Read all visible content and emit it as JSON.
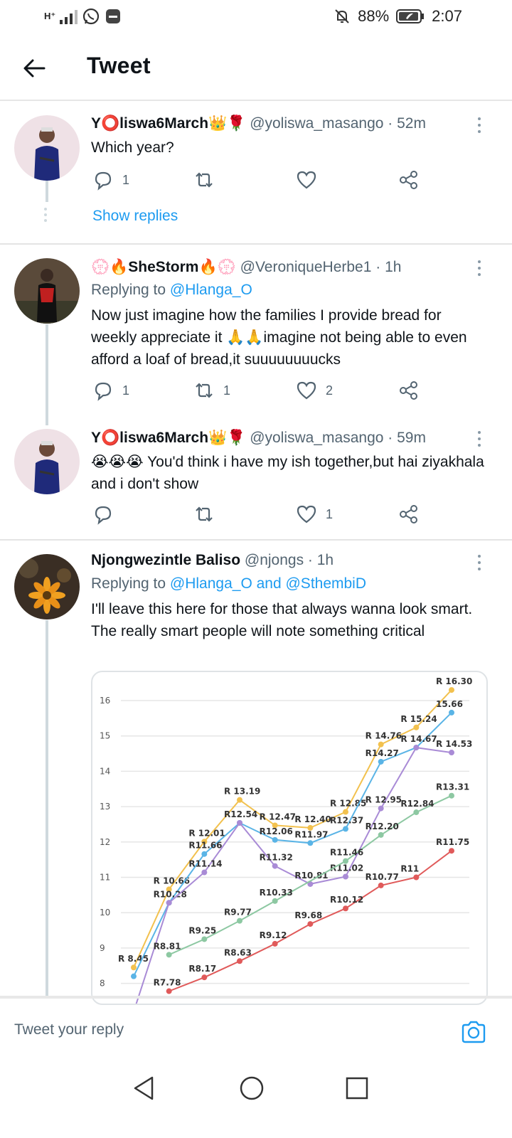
{
  "status": {
    "network": "H⁺",
    "battery": "88%",
    "time": "2:07"
  },
  "header": {
    "title": "Tweet"
  },
  "tweets": [
    {
      "name": "Y⭕liswa6March👑🌹",
      "handle": "@yoliswa_masango · 52m",
      "text": "Which year?",
      "replies": "1",
      "retweets": "",
      "likes": "",
      "show_replies": "Show replies"
    },
    {
      "name": "💮🔥SheStorm🔥💮",
      "handle": "@VeroniqueHerbe1 · 1h",
      "replying_prefix": "Replying to",
      "replying_to": "@Hlanga_O",
      "text": "Now just imagine how the families I provide bread for weekly appreciate it 🙏🙏imagine not being able to even afford a loaf of bread,it suuuuuuuucks",
      "replies": "1",
      "retweets": "1",
      "likes": "2"
    },
    {
      "name": "Y⭕liswa6March👑🌹",
      "handle": "@yoliswa_masango · 59m",
      "text": "😭😭😭 You'd think i have my ish together,but hai ziyakhala and i don't show",
      "replies": "",
      "retweets": "",
      "likes": "1"
    },
    {
      "name": "Njongwezintle Baliso",
      "handle": "@njongs · 1h",
      "replying_prefix": "Replying to",
      "replying_to": "@Hlanga_O and @SthembiD",
      "text": "I'll leave this here for those that always wanna look smart. The really smart people will note something critical"
    }
  ],
  "reply_bar": {
    "placeholder": "Tweet your reply"
  },
  "colors": {
    "accent": "#1d9bf0",
    "muted": "#536471"
  },
  "chart_data": {
    "type": "line",
    "ylim": [
      7.5,
      16.5
    ],
    "yticks": [
      8,
      9,
      10,
      11,
      12,
      13,
      14,
      15,
      16
    ],
    "x": [
      1,
      2,
      3,
      4,
      5,
      6,
      7,
      8,
      9,
      10,
      11,
      12,
      13,
      14,
      15,
      16,
      17,
      18,
      19
    ],
    "series": [
      {
        "color": "#f2c14e",
        "values": [
          8.45,
          null,
          10.66,
          null,
          12.01,
          null,
          13.19,
          null,
          12.47,
          null,
          12.4,
          null,
          12.85,
          null,
          14.76,
          null,
          15.24,
          null,
          16.3
        ],
        "labels": [
          "R 8.45",
          "",
          "R 10.66",
          "",
          "R 12.01",
          "",
          "R 13.19",
          "",
          "R 12.47",
          "",
          "R 12.40",
          "",
          "R 12.85",
          "",
          "R 14.76",
          "",
          "R 15.24",
          "",
          "R 16.30"
        ]
      },
      {
        "color": "#5ab4e6",
        "values": [
          8.2,
          null,
          10.28,
          null,
          11.66,
          null,
          12.54,
          null,
          12.06,
          null,
          11.97,
          null,
          12.37,
          null,
          14.27,
          null,
          14.67,
          null,
          15.66
        ],
        "labels": [
          "",
          "",
          "R10.28",
          "",
          "R11.66",
          "",
          "R12.54",
          "",
          "R12.06",
          "",
          "R11.97",
          "",
          "R12.37",
          "",
          "R14.27",
          "",
          "R 14.67",
          "",
          "15.66"
        ]
      },
      {
        "color": "#a98bd6",
        "values": [
          7.2,
          null,
          10.28,
          null,
          11.14,
          null,
          12.54,
          null,
          11.32,
          null,
          10.81,
          null,
          11.02,
          null,
          12.95,
          null,
          14.67,
          null,
          14.53
        ],
        "labels": [
          "",
          "",
          "",
          "",
          "R11.14",
          "",
          "",
          "",
          "R11.32",
          "",
          "R10.81",
          "",
          "R11.02",
          "",
          "R 12.95",
          "",
          "",
          "",
          "R 14.53"
        ]
      },
      {
        "color": "#8dc8a2",
        "values": [
          null,
          null,
          8.81,
          null,
          9.25,
          null,
          9.77,
          null,
          10.33,
          null,
          null,
          null,
          11.46,
          null,
          12.2,
          null,
          12.84,
          null,
          13.31
        ],
        "labels": [
          "",
          "",
          "R8.81",
          "",
          "R9.25",
          "",
          "R9.77",
          "",
          "R10.33",
          "",
          "",
          "",
          "R11.46",
          "",
          "R12.20",
          "",
          "R12.84",
          "",
          "R13.31"
        ]
      },
      {
        "color": "#e05a5a",
        "values": [
          null,
          null,
          7.78,
          null,
          8.17,
          null,
          8.63,
          null,
          9.12,
          null,
          9.68,
          null,
          10.12,
          null,
          10.77,
          null,
          11,
          null,
          11.75
        ],
        "labels": [
          "",
          "",
          "R7.78",
          "",
          "R8.17",
          "",
          "R8.63",
          "",
          "R9.12",
          "",
          "R9.68",
          "",
          "R10.12",
          "",
          "R10.77",
          "",
          "R11",
          "",
          "R11.75"
        ]
      }
    ]
  }
}
